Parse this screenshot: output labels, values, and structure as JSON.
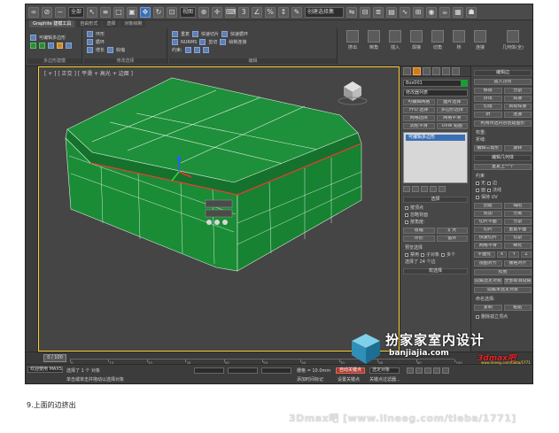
{
  "toolbar": {
    "dropdown_1": "全部",
    "dropdown_2": "视图",
    "dropdown_3": "创建选择集"
  },
  "ribbon": {
    "tabs": [
      "Graphite 建模工具",
      "自由形式",
      "选择",
      "对象绘制"
    ],
    "group_labels": [
      "多边形建模",
      "修改选择",
      "编辑"
    ],
    "group1_rows": [
      "可编辑多边形"
    ],
    "group2_rows": [
      "环形",
      "循环",
      "增长",
      "收缩"
    ],
    "group3_rows": [
      "重复",
      "快速切片",
      "快速循环",
      "NURMS",
      "剪切",
      "绘制连接",
      "约束:"
    ],
    "big_buttons": [
      "挤出",
      "倒角",
      "插入",
      "焊接",
      "切角",
      "桥",
      "连接",
      "几何体(全)"
    ]
  },
  "viewport": {
    "label": "[ + ] [ 正交 ] [ 平滑 + 高光 + 边面 ]"
  },
  "command_panel": {
    "object_name": "Box001",
    "modifier_list": "修改器列表",
    "buttons": [
      "可编辑网格",
      "面片选择",
      "FFD 选择",
      "多边形选择",
      "网格选择",
      "网格平滑",
      "涡轮平滑",
      "UVW 贴图"
    ],
    "stack_item": "可编辑多边形",
    "selection_header": "选择",
    "checks": [
      "按顶点",
      "忽略背面",
      "按角度:"
    ],
    "shrink_grow": [
      "收缩",
      "扩大",
      "环形",
      "循环"
    ],
    "preview_label": "预览选择",
    "preview_opts": [
      "禁用",
      "子对象",
      "多个"
    ],
    "selected_info": "选择了 24 个边",
    "soft_selection": "软选择"
  },
  "right_panel": {
    "header": "编辑边",
    "buttons": [
      "插入顶点",
      "移除",
      "分割",
      "挤出",
      "焊接",
      "切角",
      "目标焊接",
      "桥",
      "连接",
      "利用所选内容创建图形",
      "权重:",
      "折缝:",
      "编辑三角形",
      "旋转",
      "编辑几何体",
      "重复上一个",
      "约束",
      "无",
      "边",
      "面",
      "法线",
      "保持 UV",
      "创建",
      "塌陷",
      "附加",
      "分离",
      "切片平面",
      "分割",
      "切片",
      "重置平面",
      "快速切片",
      "切割",
      "网格平滑",
      "细化",
      "平面化",
      "X",
      "Y",
      "Z",
      "视图对齐",
      "栅格对齐",
      "松弛",
      "隐藏选定对象",
      "全部取消隐藏",
      "隐藏未选定对象",
      "命名选择:",
      "复制",
      "粘贴",
      "删除孤立顶点"
    ]
  },
  "timeline": {
    "frame_slider": "0 / 100",
    "ticks": [
      "0",
      "10",
      "20",
      "30",
      "40",
      "50",
      "60",
      "70",
      "80",
      "90",
      "100"
    ]
  },
  "status": {
    "line1": "选择了 1 个 对象",
    "line2": "单击或单击并拖动以选择对象",
    "welcome": "欢迎使用 MAXS",
    "grid": "栅格 = 10.0mm",
    "autokey": "自动关键点",
    "set_key": "设置关键点",
    "selected": "选定对象",
    "add_time_tag": "添加时间标记",
    "key_filter": "关键点过滤器..."
  },
  "watermark": {
    "title": "扮家家室内设计",
    "url": "banjiajia.com",
    "brand": "3dmax吧",
    "brand_sub": "www.lineeg.com/tieba/1771"
  },
  "caption": "9.上面的边挤出",
  "footer_watermark": "3Dmax吧 [www.lineeg.com/tieba/1771]"
}
